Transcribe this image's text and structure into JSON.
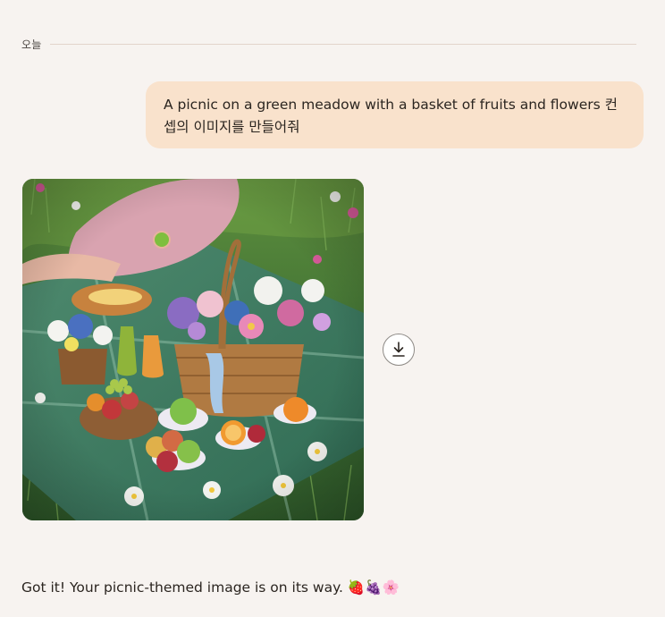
{
  "day_divider": {
    "label": "오늘"
  },
  "user_message": {
    "text": "A picnic on a green meadow with a basket of fruits and flowers 컨셉의 이미지를 만들어줘"
  },
  "generated_image": {
    "icon": "photo-picnic-meadow"
  },
  "download_button": {
    "icon": "download-icon"
  },
  "assistant_message": {
    "text": "Got it! Your picnic-themed image is on its way. 🍓🍇🌸"
  },
  "colors": {
    "background": "#F7F3F0",
    "user_bubble": "#F9E2CC",
    "divider": "#E2D5CB",
    "text": "#2B2520"
  }
}
